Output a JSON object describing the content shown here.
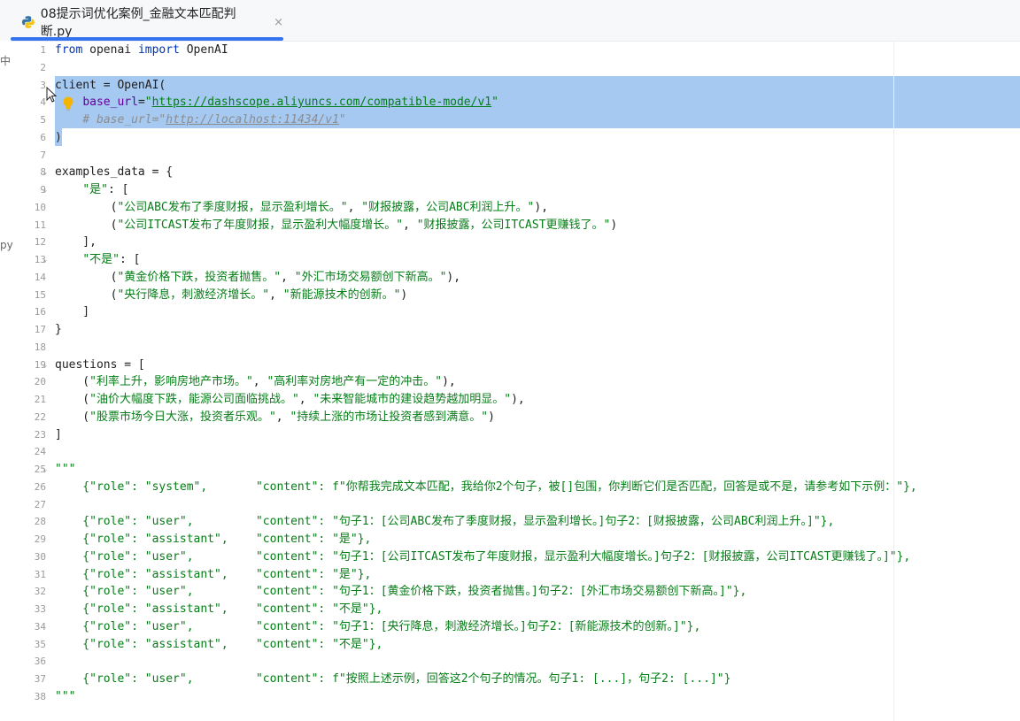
{
  "tab": {
    "title": "08提示词优化案例_金融文本匹配判断.py",
    "close": "×"
  },
  "left_fragments": [
    "中",
    "py"
  ],
  "code": {
    "line_numbers": [
      "1",
      "2",
      "3",
      "4",
      "5",
      "6",
      "7",
      "8",
      "9",
      "10",
      "11",
      "12",
      "13",
      "14",
      "15",
      "16",
      "17",
      "18",
      "19",
      "20",
      "21",
      "22",
      "23",
      "24",
      "25",
      "26",
      "27",
      "28",
      "29",
      "30",
      "31",
      "32",
      "33",
      "34",
      "35",
      "36",
      "37",
      "38"
    ],
    "lines": [
      [
        {
          "t": "from",
          "c": "kw"
        },
        {
          "t": " openai "
        },
        {
          "t": "import",
          "c": "kw"
        },
        {
          "t": " OpenAI"
        }
      ],
      [],
      [
        {
          "t": "client = OpenAI("
        }
      ],
      [
        {
          "t": "    "
        },
        {
          "t": "base_url",
          "c": "param"
        },
        {
          "t": "="
        },
        {
          "t": "\"",
          "c": "str"
        },
        {
          "t": "https://dashscope.aliyuncs.com/compatible-mode/v1",
          "c": "url"
        },
        {
          "t": "\"",
          "c": "str"
        }
      ],
      [
        {
          "t": "    # base_url=\"",
          "c": "cmt"
        },
        {
          "t": "http://localhost:11434/v1",
          "c": "cmt-url"
        },
        {
          "t": "\"",
          "c": "cmt"
        }
      ],
      [
        {
          "t": ")"
        }
      ],
      [],
      [
        {
          "t": "examples_data = {"
        }
      ],
      [
        {
          "t": "    "
        },
        {
          "t": "\"是\"",
          "c": "str"
        },
        {
          "t": ": ["
        }
      ],
      [
        {
          "t": "        ("
        },
        {
          "t": "\"公司ABC发布了季度财报，显示盈利增长。\"",
          "c": "str"
        },
        {
          "t": ", "
        },
        {
          "t": "\"财报披露，公司ABC利润上升。\"",
          "c": "str"
        },
        {
          "t": "),"
        }
      ],
      [
        {
          "t": "        ("
        },
        {
          "t": "\"公司ITCAST发布了年度财报，显示盈利大幅度增长。\"",
          "c": "str"
        },
        {
          "t": ", "
        },
        {
          "t": "\"财报披露，公司ITCAST更赚钱了。\"",
          "c": "str"
        },
        {
          "t": ")"
        }
      ],
      [
        {
          "t": "    ],"
        }
      ],
      [
        {
          "t": "    "
        },
        {
          "t": "\"不是\"",
          "c": "str"
        },
        {
          "t": ": ["
        }
      ],
      [
        {
          "t": "        ("
        },
        {
          "t": "\"黄金价格下跌，投资者抛售。\"",
          "c": "str"
        },
        {
          "t": ", "
        },
        {
          "t": "\"外汇市场交易额创下新高。\"",
          "c": "str"
        },
        {
          "t": "),"
        }
      ],
      [
        {
          "t": "        ("
        },
        {
          "t": "\"央行降息，刺激经济增长。\"",
          "c": "str"
        },
        {
          "t": ", "
        },
        {
          "t": "\"新能源技术的创新。\"",
          "c": "str"
        },
        {
          "t": ")"
        }
      ],
      [
        {
          "t": "    ]"
        }
      ],
      [
        {
          "t": "}"
        }
      ],
      [],
      [
        {
          "t": "questions = ["
        }
      ],
      [
        {
          "t": "    ("
        },
        {
          "t": "\"利率上升，影响房地产市场。\"",
          "c": "str"
        },
        {
          "t": ", "
        },
        {
          "t": "\"高利率对房地产有一定的冲击。\"",
          "c": "str"
        },
        {
          "t": "),"
        }
      ],
      [
        {
          "t": "    ("
        },
        {
          "t": "\"油价大幅度下跌，能源公司面临挑战。\"",
          "c": "str"
        },
        {
          "t": ", "
        },
        {
          "t": "\"未来智能城市的建设趋势越加明显。\"",
          "c": "str"
        },
        {
          "t": "),"
        }
      ],
      [
        {
          "t": "    ("
        },
        {
          "t": "\"股票市场今日大涨，投资者乐观。\"",
          "c": "str"
        },
        {
          "t": ", "
        },
        {
          "t": "\"持续上涨的市场让投资者感到满意。\"",
          "c": "str"
        },
        {
          "t": ")"
        }
      ],
      [
        {
          "t": "]"
        }
      ],
      [],
      [
        {
          "t": "\"\"\"",
          "c": "str"
        }
      ],
      [
        {
          "t": "    {\"role\": \"system\",       \"content\": f\"你帮我完成文本匹配，我给你2个句子，被[]包围，你判断它们是否匹配，回答是或不是，请参考如下示例：\"},",
          "c": "str"
        }
      ],
      [],
      [
        {
          "t": "    {\"role\": \"user\",         \"content\": \"句子1：[公司ABC发布了季度财报，显示盈利增长。]句子2：[财报披露，公司ABC利润上升。]\"},",
          "c": "str"
        }
      ],
      [
        {
          "t": "    {\"role\": \"assistant\",    \"content\": \"是\"},",
          "c": "str"
        }
      ],
      [
        {
          "t": "    {\"role\": \"user\",         \"content\": \"句子1：[公司ITCAST发布了年度财报，显示盈利大幅度增长。]句子2：[财报披露，公司ITCAST更赚钱了。]\"},",
          "c": "str"
        }
      ],
      [
        {
          "t": "    {\"role\": \"assistant\",    \"content\": \"是\"},",
          "c": "str"
        }
      ],
      [
        {
          "t": "    {\"role\": \"user\",         \"content\": \"句子1：[黄金价格下跌，投资者抛售。]句子2：[外汇市场交易额创下新高。]\"},",
          "c": "str"
        }
      ],
      [
        {
          "t": "    {\"role\": \"assistant\",    \"content\": \"不是\"},",
          "c": "str"
        }
      ],
      [
        {
          "t": "    {\"role\": \"user\",         \"content\": \"句子1：[央行降息，刺激经济增长。]句子2：[新能源技术的创新。]\"},",
          "c": "str"
        }
      ],
      [
        {
          "t": "    {\"role\": \"assistant\",    \"content\": \"不是\"},",
          "c": "str"
        }
      ],
      [],
      [
        {
          "t": "    {\"role\": \"user\",         \"content\": f\"按照上述示例，回答这2个句子的情况。句子1: [...]，句子2: [...]\"}",
          "c": "str"
        }
      ],
      [
        {
          "t": "\"\"\"",
          "c": "str"
        }
      ]
    ]
  },
  "colors": {
    "keyword": "#0033b3",
    "string": "#067d17",
    "comment": "#8c8c8c",
    "selection": "#a6c9f2",
    "tab_accent": "#3574f0"
  },
  "icons": [
    "python-file-icon",
    "close-icon",
    "lightbulb-icon",
    "mouse-cursor-icon",
    "fold-arrow-icon"
  ]
}
